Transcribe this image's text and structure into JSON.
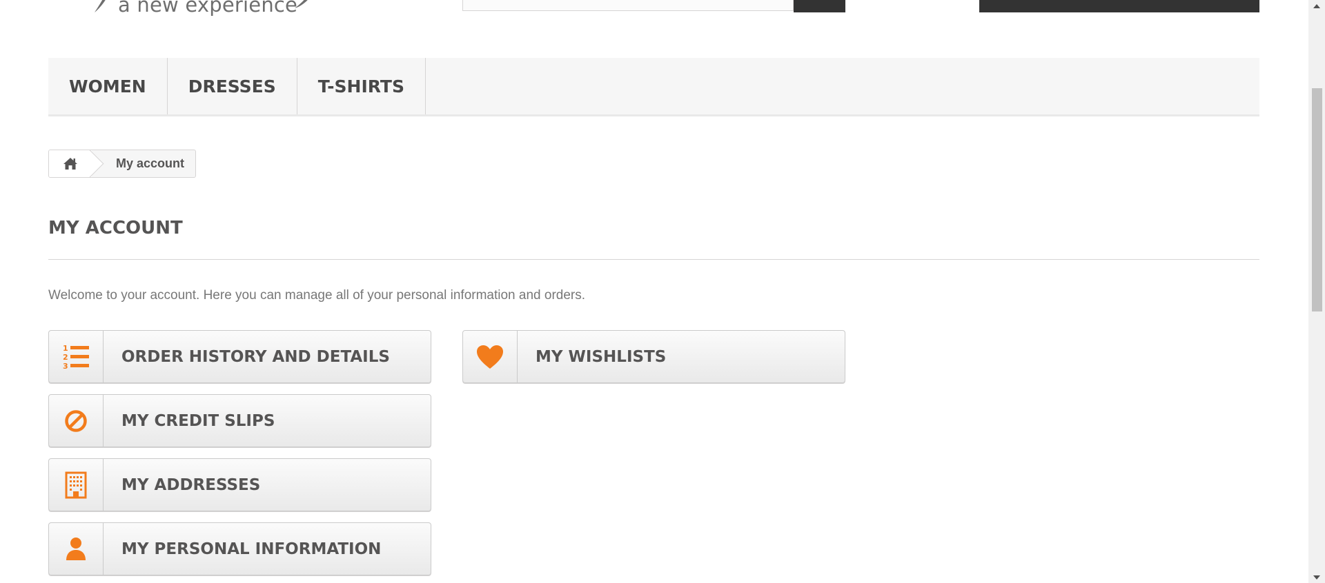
{
  "header": {
    "logo_tagline": "a new experience"
  },
  "menu": {
    "items": [
      {
        "label": "Women"
      },
      {
        "label": "Dresses"
      },
      {
        "label": "T-shirts"
      }
    ]
  },
  "breadcrumb": {
    "home_icon": "home-icon",
    "current": "My account"
  },
  "page": {
    "heading": "My account",
    "info": "Welcome to your account. Here you can manage all of your personal information and orders."
  },
  "account_links": {
    "order_history": {
      "label": "Order history and details",
      "icon": "ordered-list-icon"
    },
    "credit_slips": {
      "label": "My credit slips",
      "icon": "ban-icon"
    },
    "addresses": {
      "label": "My addresses",
      "icon": "building-icon"
    },
    "personal_info": {
      "label": "My personal information",
      "icon": "user-icon"
    },
    "wishlists": {
      "label": "My wishlists",
      "icon": "heart-icon"
    }
  },
  "colors": {
    "accent": "#f27c1c",
    "menu_background": "#f6f6f6",
    "dark_block": "#333333",
    "text_dark": "#555454"
  }
}
